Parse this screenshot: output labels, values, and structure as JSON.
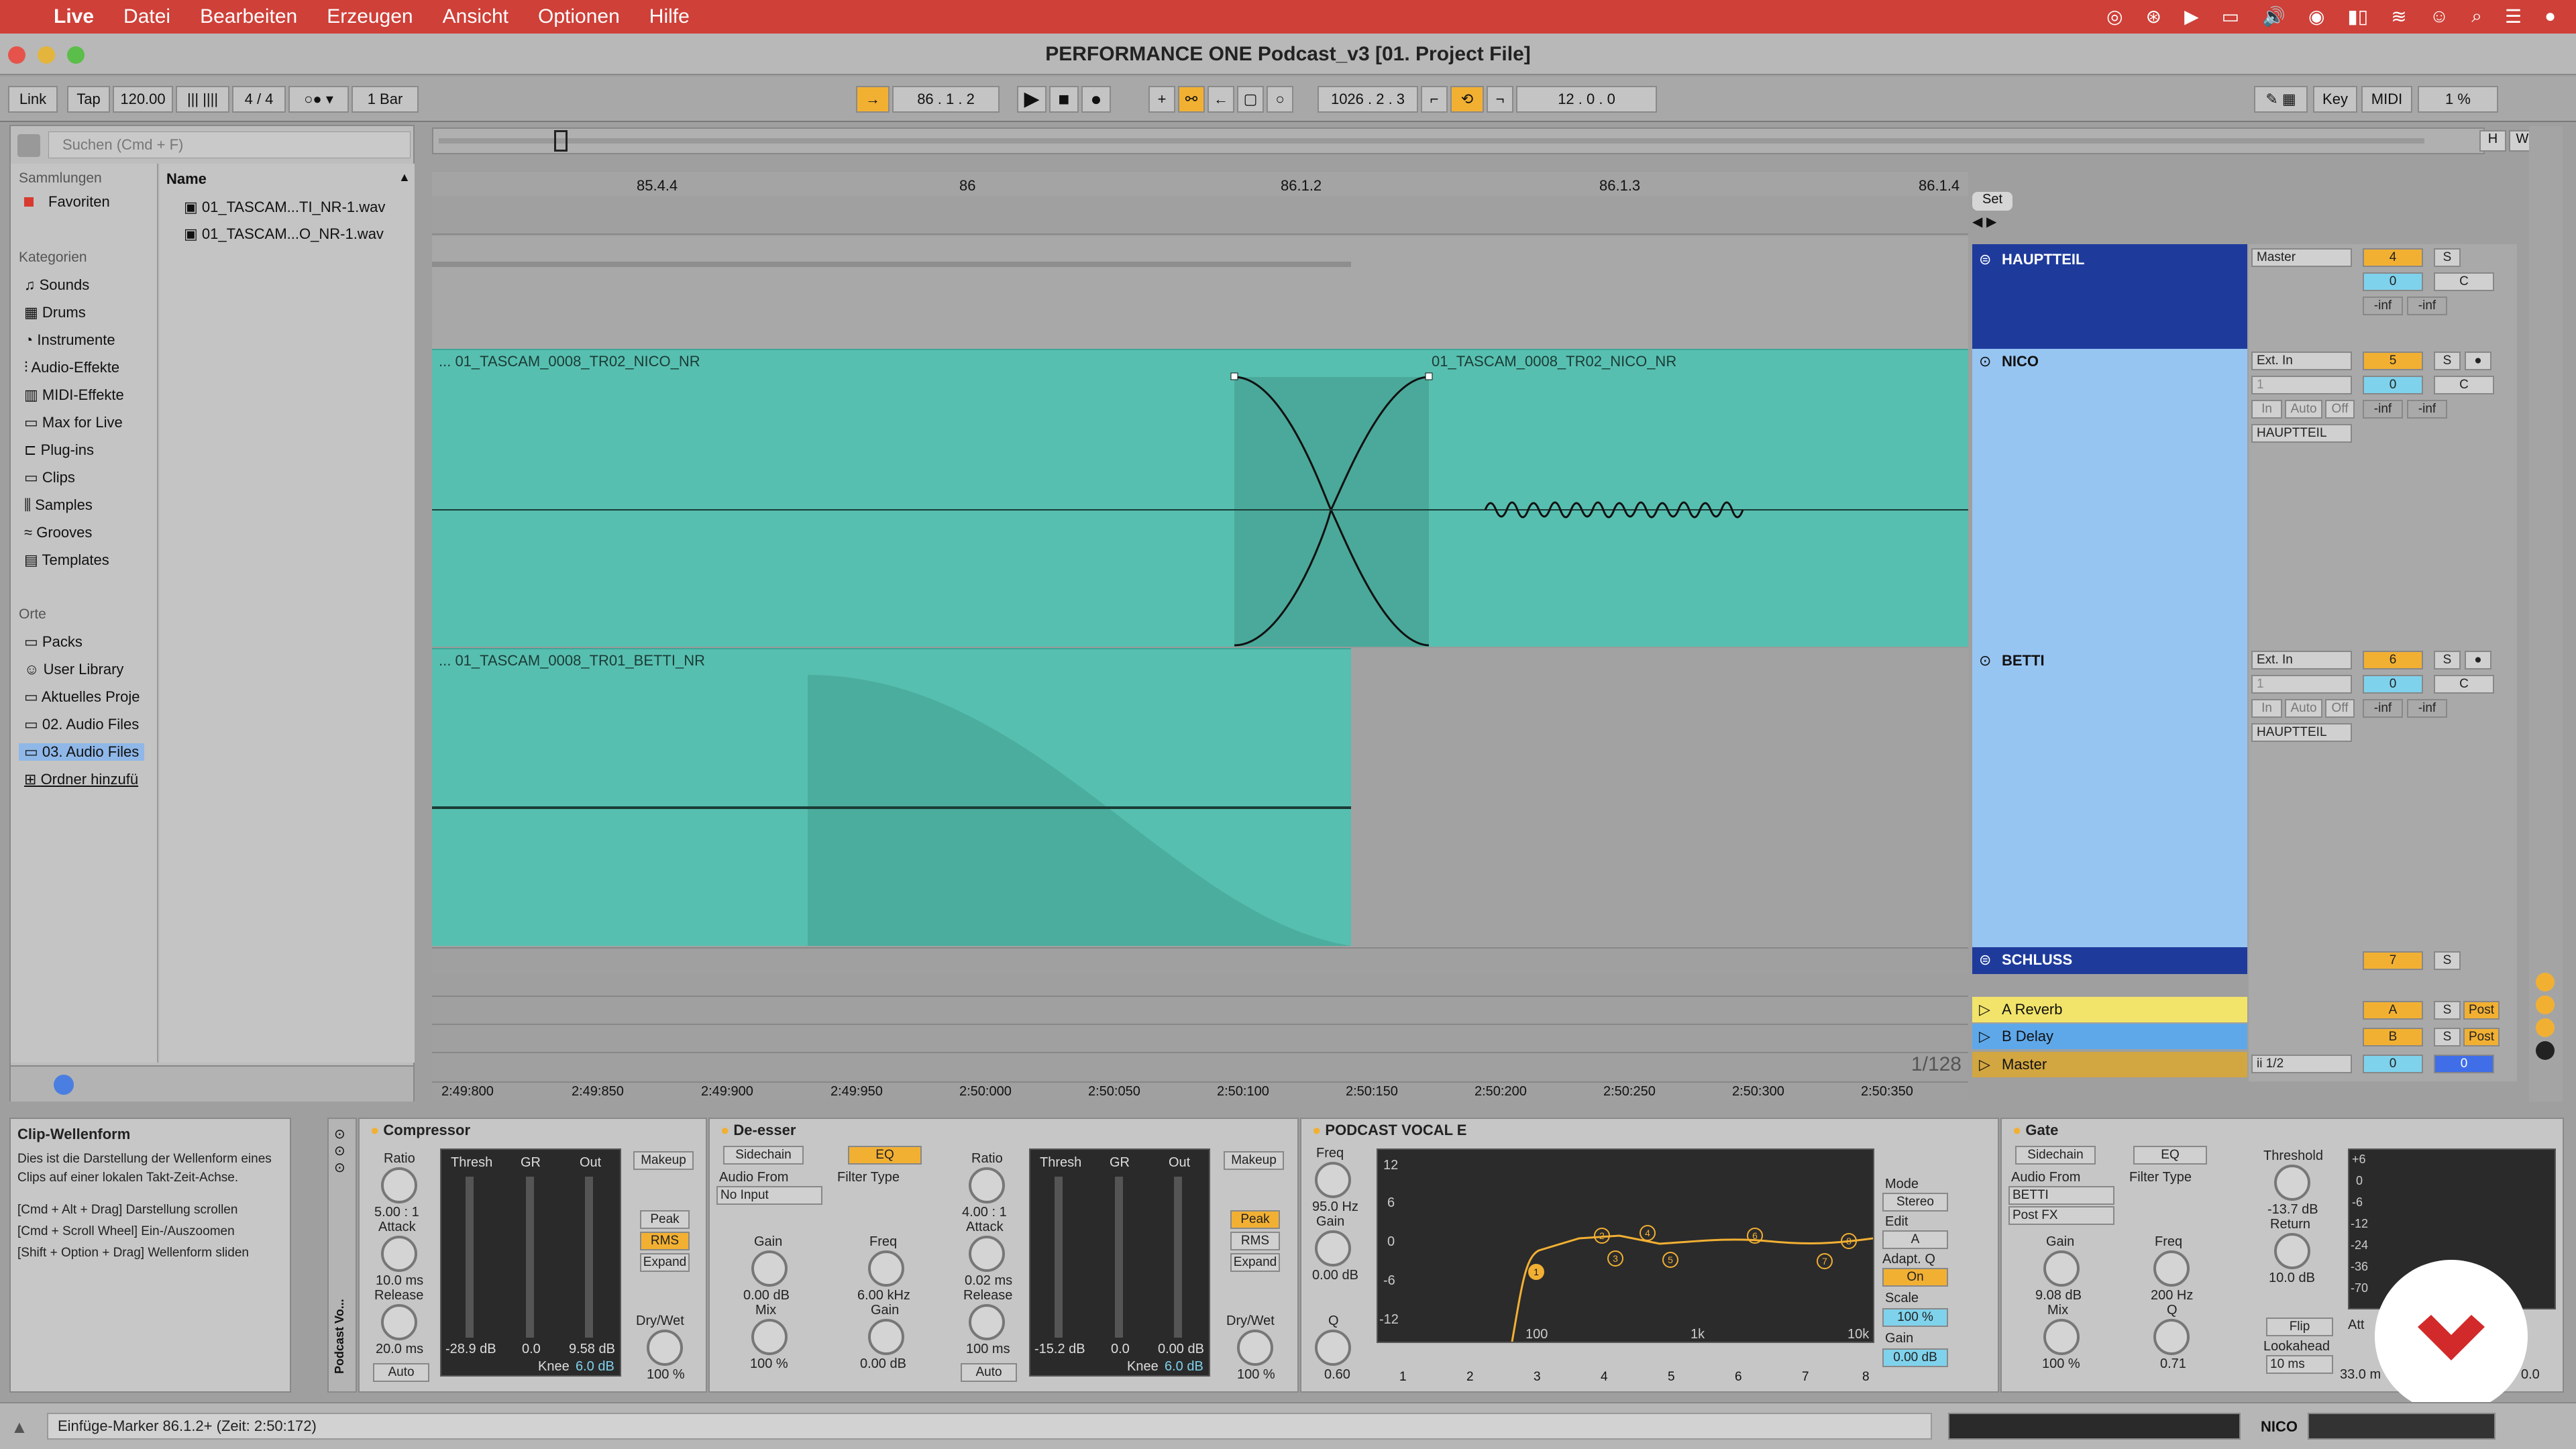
{
  "menubar": {
    "app": "Live",
    "items": [
      "Datei",
      "Bearbeiten",
      "Erzeugen",
      "Ansicht",
      "Optionen",
      "Hilfe"
    ]
  },
  "window": {
    "title": "PERFORMANCE ONE Podcast_v3  [01. Project File]"
  },
  "transport": {
    "link": "Link",
    "tap": "Tap",
    "tempo": "120.00",
    "signature": "4 / 4",
    "quantize": "1 Bar",
    "position": "86 .  1 .  2",
    "loop_start": "1026 .  2 .  3",
    "loop_length": "12 .  0 .  0",
    "key": "Key",
    "midi": "MIDI",
    "cpu": "1 %"
  },
  "browser": {
    "search_placeholder": "Suchen (Cmd + F)",
    "sammlungen": "Sammlungen",
    "favoriten": "Favoriten",
    "kategorien": "Kategorien",
    "categories": [
      "Sounds",
      "Drums",
      "Instrumente",
      "Audio-Effekte",
      "MIDI-Effekte",
      "Max for Live",
      "Plug-ins",
      "Clips",
      "Samples",
      "Grooves",
      "Templates"
    ],
    "orte": "Orte",
    "places": [
      "Packs",
      "User Library",
      "Aktuelles Proje",
      "02. Audio Files",
      "03. Audio Files",
      "Ordner hinzufü"
    ],
    "name_header": "Name",
    "files": [
      "01_TASCAM...TI_NR-1.wav",
      "01_TASCAM...O_NR-1.wav"
    ]
  },
  "ruler": {
    "marks": [
      "85.4.4",
      "86",
      "86.1.2",
      "86.1.3",
      "86.1.4"
    ],
    "set": "Set"
  },
  "time_ruler": {
    "marks": [
      "2:49:800",
      "2:49:850",
      "2:49:900",
      "2:49:950",
      "2:50:000",
      "2:50:050",
      "2:50:100",
      "2:50:150",
      "2:50:200",
      "2:50:250",
      "2:50:300",
      "2:50:350"
    ],
    "zoom": "1/128"
  },
  "tracks": [
    {
      "name": "HAUPTTEIL",
      "output": "Master",
      "number": "4",
      "s": "S",
      "vol": "0",
      "pan": "C",
      "l": "-inf",
      "r": "-inf"
    },
    {
      "name": "NICO",
      "input": "Ext. In",
      "ch": "1",
      "number": "5",
      "s": "S",
      "vol": "0",
      "pan": "C",
      "in": "In",
      "auto": "Auto",
      "off": "Off",
      "group": "HAUPTTEIL",
      "l": "-inf",
      "r": "-inf",
      "clip_a": "... 01_TASCAM_0008_TR02_NICO_NR",
      "clip_b": "01_TASCAM_0008_TR02_NICO_NR"
    },
    {
      "name": "BETTI",
      "input": "Ext. In",
      "ch": "1",
      "number": "6",
      "s": "S",
      "vol": "0",
      "pan": "C",
      "in": "In",
      "auto": "Auto",
      "off": "Off",
      "group": "HAUPTTEIL",
      "l": "-inf",
      "r": "-inf",
      "clip_a": "... 01_TASCAM_0008_TR01_BETTI_NR"
    },
    {
      "name": "SCHLUSS",
      "number": "7",
      "s": "S"
    }
  ],
  "returns": [
    {
      "name": "A Reverb",
      "letter": "A",
      "s": "S",
      "post": "Post"
    },
    {
      "name": "B Delay",
      "letter": "B",
      "s": "S",
      "post": "Post"
    },
    {
      "name": "Master",
      "sel": "ii 1/2",
      "vol": "0",
      "pan": "0"
    }
  ],
  "info": {
    "title": "Clip-Wellenform",
    "text": "Dies ist die Darstellung der Wellenform eines Clips auf einer lokalen Takt-Zeit-Achse.",
    "h1": "[Cmd + Alt + Drag] Darstellung scrollen",
    "h2": "[Cmd + Scroll Wheel] Ein-/Auszoomen",
    "h3": "[Shift + Option + Drag] Wellenform sliden"
  },
  "rack_label": "Podcast Vo...",
  "compressor": {
    "title": "Compressor",
    "ratio_l": "Ratio",
    "ratio": "5.00 : 1",
    "attack_l": "Attack",
    "attack": "10.0 ms",
    "release_l": "Release",
    "release": "20.0 ms",
    "auto": "Auto",
    "thresh": "Thresh",
    "gr": "GR",
    "out": "Out",
    "thresh_v": "-28.9 dB",
    "gr_v": "0.0",
    "out_v": "9.58 dB",
    "makeup": "Makeup",
    "peak": "Peak",
    "rms": "RMS",
    "expand": "Expand",
    "knee": "Knee",
    "knee_v": "6.0 dB",
    "drywet": "Dry/Wet",
    "drywet_v": "100 %"
  },
  "deesser": {
    "title": "De-esser",
    "sidechain": "Sidechain",
    "eq": "EQ",
    "audio_from": "Audio From",
    "no_input": "No Input",
    "filter_type": "Filter Type",
    "gain": "Gain",
    "gain_v": "0.00 dB",
    "freq": "Freq",
    "freq_v": "6.00 kHz",
    "mix": "Mix",
    "mix_v": "100 %",
    "gain2": "Gain",
    "gain2_v": "0.00 dB",
    "ratio": "Ratio",
    "ratio_v": "4.00 : 1",
    "attack": "Attack",
    "attack_v": "0.02 ms",
    "release": "Release",
    "release_v": "100 ms",
    "auto": "Auto",
    "thresh": "Thresh",
    "gr": "GR",
    "out": "Out",
    "thresh_v": "-15.2 dB",
    "gr_v": "0.0",
    "out_v": "0.00 dB",
    "makeup": "Makeup",
    "peak": "Peak",
    "rms": "RMS",
    "expand": "Expand",
    "knee": "Knee",
    "knee_v": "6.0 dB",
    "drywet": "Dry/Wet",
    "drywet_v": "100 %"
  },
  "eq": {
    "title": "PODCAST VOCAL E",
    "freq": "Freq",
    "freq_v": "95.0 Hz",
    "gain": "Gain",
    "gain_v": "0.00 dB",
    "q": "Q",
    "q_v": "0.60",
    "db": [
      "12",
      "6",
      "0",
      "-6",
      "-12"
    ],
    "hz": [
      "100",
      "1k",
      "10k"
    ],
    "mode": "Mode",
    "stereo": "Stereo",
    "edit": "Edit",
    "a": "A",
    "adapt": "Adapt. Q",
    "on": "On",
    "scale": "Scale",
    "scale_v": "100 %",
    "gain2": "Gain",
    "gain2_v": "0.00 dB",
    "bands": [
      "1",
      "2",
      "3",
      "4",
      "5",
      "6",
      "7",
      "8"
    ]
  },
  "gate": {
    "title": "Gate",
    "sidechain": "Sidechain",
    "eq": "EQ",
    "audio_from": "Audio From",
    "source": "BETTI",
    "tap": "Post FX",
    "filter_type": "Filter Type",
    "gain": "Gain",
    "gain_v": "9.08 dB",
    "freq": "Freq",
    "freq_v": "200 Hz",
    "mix": "Mix",
    "mix_v": "100 %",
    "q": "Q",
    "q_v": "0.71",
    "threshold": "Threshold",
    "threshold_v": "-13.7 dB",
    "return": "Return",
    "return_v": "10.0 dB",
    "flip": "Flip",
    "lookahead": "Lookahead",
    "lookahead_v": "10 ms",
    "att": "Att",
    "att_v": "33.0 m",
    "rel": "ase",
    "rel_v": "0.0",
    "scale": [
      "+6",
      "0",
      "-6",
      "-12",
      "-24",
      "-36",
      "-70"
    ]
  },
  "status": {
    "text": "Einfüge-Marker 86.1.2+ (Zeit: 2:50:172)",
    "track": "NICO"
  },
  "colors": {
    "clip": "#57bfb0",
    "group": "#1e3b9c",
    "track": "#97c5f2",
    "accent": "#f2b033",
    "menubar": "#ce4038"
  }
}
